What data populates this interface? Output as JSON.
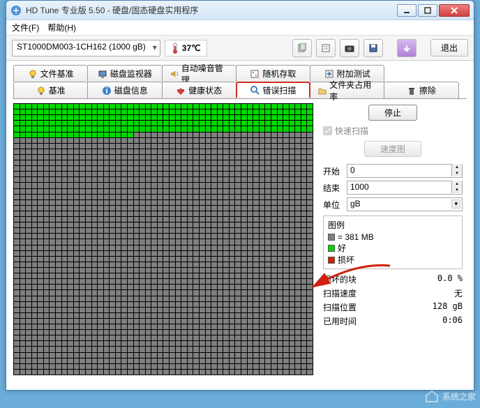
{
  "window": {
    "title": "HD Tune 专业版 5.50 - 硬盘/固态硬盘实用程序"
  },
  "menu": {
    "file": "文件(F)",
    "help": "帮助(H)"
  },
  "toolbar": {
    "drive": "ST1000DM003-1CH162 (1000 gB)",
    "temp": "37℃",
    "exit": "退出"
  },
  "tabs": {
    "row1": [
      {
        "label": "文件基准",
        "icon": "bulb"
      },
      {
        "label": "磁盘监视器",
        "icon": "monitor"
      },
      {
        "label": "自动噪音管理",
        "icon": "speaker"
      },
      {
        "label": "随机存取",
        "icon": "random"
      },
      {
        "label": "附加测试",
        "icon": "extra"
      }
    ],
    "row2": [
      {
        "label": "基准",
        "icon": "bulb"
      },
      {
        "label": "磁盘信息",
        "icon": "info"
      },
      {
        "label": "健康状态",
        "icon": "health"
      },
      {
        "label": "错误扫描",
        "icon": "search",
        "active": true
      },
      {
        "label": "文件夹占用率",
        "icon": "folder"
      },
      {
        "label": "擦除",
        "icon": "trash"
      }
    ]
  },
  "scan": {
    "stop": "停止",
    "quick": "快速扫描",
    "speedmap": "速度图",
    "start_label": "开始",
    "start_val": "0",
    "end_label": "结束",
    "end_val": "1000",
    "unit_label": "单位",
    "unit_val": "gB"
  },
  "legend": {
    "title": "图例",
    "block": "= 381 MB",
    "ok": "好",
    "bad": "损坏"
  },
  "stats": {
    "damaged_label": "损坏的块",
    "damaged_val": "0.0 %",
    "speed_label": "扫描速度",
    "speed_val": "无",
    "pos_label": "扫描位置",
    "pos_val": "128 gB",
    "time_label": "已用时间",
    "time_val": "0:06"
  },
  "watermark": "系统之家",
  "grid": {
    "total_cells": 2400,
    "ok_cells": 270
  }
}
